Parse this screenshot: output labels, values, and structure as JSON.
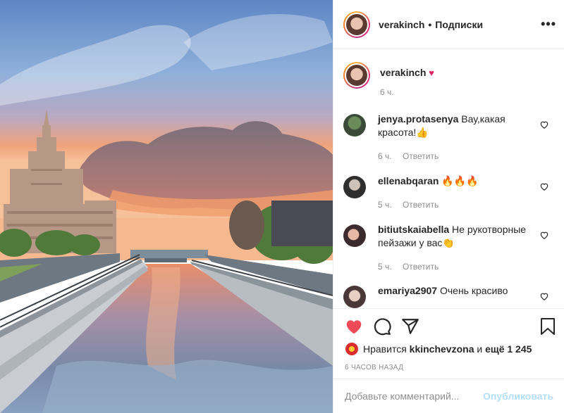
{
  "header": {
    "username": "verakinch",
    "separator": "•",
    "follow_label": "Подписки",
    "more_label": "•••"
  },
  "caption": {
    "username": "verakinch",
    "emoji": "♥",
    "time": "6 ч."
  },
  "comments": [
    {
      "username": "jenya.protasenya",
      "text": "Вау,какая красота!👍",
      "time": "6 ч.",
      "reply": "Ответить"
    },
    {
      "username": "ellenabqaran",
      "text": "🔥🔥🔥",
      "time": "5 ч.",
      "reply": "Ответить"
    },
    {
      "username": "bitiutskaiabella",
      "text": "Не рукотворные пейзажи у вас👏",
      "time": "5 ч.",
      "reply": "Ответить"
    },
    {
      "username": "emariya2907",
      "text": "Очень красиво",
      "time": "",
      "reply": ""
    }
  ],
  "likes": {
    "prefix": "Нравится",
    "user": "kkinchevzona",
    "middle": "и",
    "count": "ещё 1 245"
  },
  "time_ago": "6 ЧАСОВ НАЗАД",
  "add_comment": {
    "placeholder": "Добавьте комментарий...",
    "publish_label": "Опубликовать"
  },
  "colors": {
    "like_red": "#ed4956",
    "publish_disabled": "#b2dffc",
    "secondary_text": "#8e8e8e"
  }
}
